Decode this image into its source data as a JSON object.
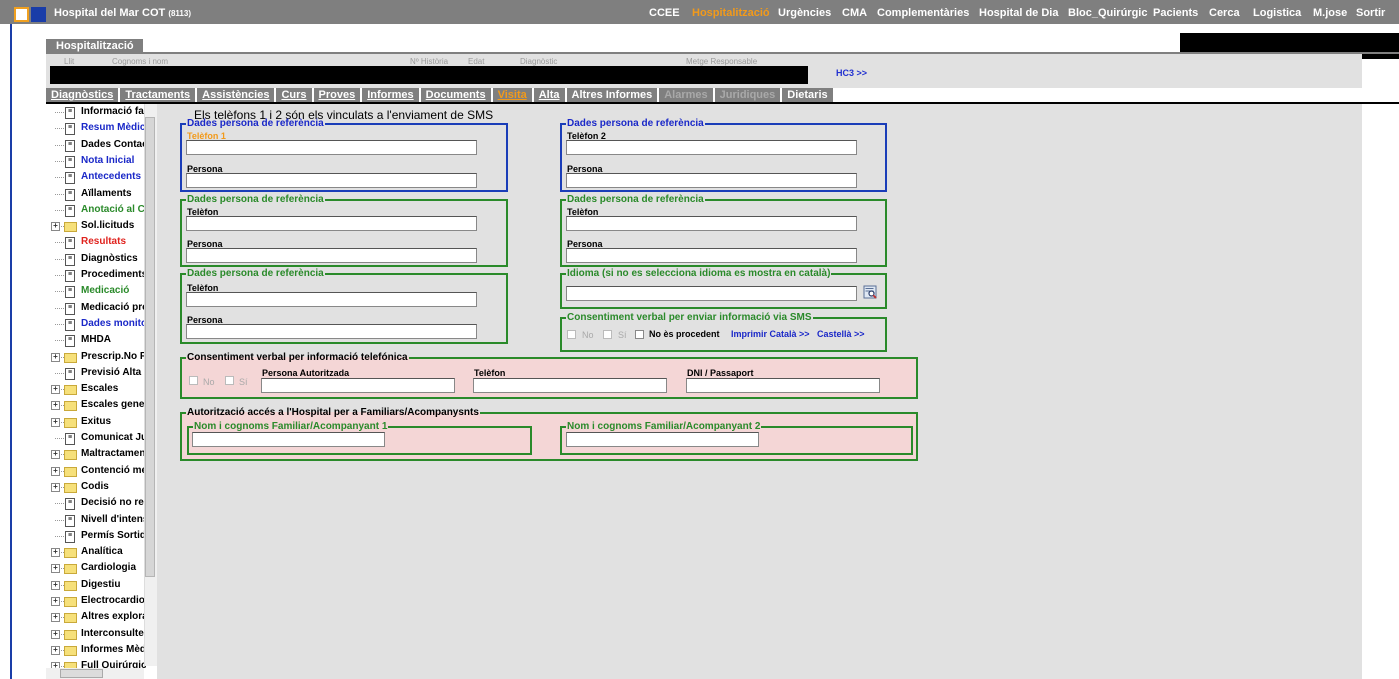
{
  "topbar": {
    "app_title": "Hospital del Mar  COT",
    "app_code": "(8113)",
    "menu": [
      "CCEE",
      "Hospitalització",
      "Urgències",
      "CMA",
      "Complementàries",
      "Hospital de Dia",
      "Bloc_Quirúrgic",
      "Pacients",
      "Cerca",
      "Logistica",
      "M.jose",
      "Sortir"
    ],
    "active_menu": "Hospitalització"
  },
  "patient_header": {
    "tab_label": "Hospitalització",
    "captions": {
      "llit": "Llit",
      "cognoms": "Cognoms i nom",
      "historia": "Nº Història",
      "edat": "Edat",
      "diagnostic": "Diagnòstic",
      "metge": "Metge Responsable"
    },
    "hc3_link": "HC3 >>"
  },
  "tabs": [
    "Diagnòstics",
    "Tractaments",
    "Assistències",
    "Curs",
    "Proves",
    "Informes",
    "Documents",
    "Visita",
    "Alta",
    "Altres Informes",
    "Alarmes",
    "Juridiques",
    "Dietaris"
  ],
  "tree": [
    {
      "label": "Informació fam",
      "kind": "doc",
      "color": "black"
    },
    {
      "label": "Resum Mèdic",
      "kind": "doc",
      "color": "blue"
    },
    {
      "label": "Dades Contacte",
      "kind": "doc",
      "color": "black"
    },
    {
      "label": "Nota Inicial",
      "kind": "doc",
      "color": "blue"
    },
    {
      "label": "Antecedents",
      "kind": "doc",
      "color": "blue"
    },
    {
      "label": "Aïllaments",
      "kind": "doc",
      "color": "black"
    },
    {
      "label": "Anotació al Cur",
      "kind": "doc",
      "color": "green"
    },
    {
      "label": "Sol.licituds",
      "kind": "folder",
      "color": "black"
    },
    {
      "label": "Resultats",
      "kind": "doc",
      "color": "red"
    },
    {
      "label": "Diagnòstics",
      "kind": "doc",
      "color": "black"
    },
    {
      "label": "Procediments",
      "kind": "doc",
      "color": "black"
    },
    {
      "label": "Medicació",
      "kind": "doc",
      "color": "green"
    },
    {
      "label": "Medicació prev",
      "kind": "doc",
      "color": "black"
    },
    {
      "label": "Dades monitor",
      "kind": "doc",
      "color": "blue"
    },
    {
      "label": "MHDA",
      "kind": "doc",
      "color": "black"
    },
    {
      "label": "Prescrip.No Fa",
      "kind": "folder",
      "color": "black"
    },
    {
      "label": "Previsió Alta / A",
      "kind": "doc",
      "color": "black"
    },
    {
      "label": "Escales",
      "kind": "folder",
      "color": "black"
    },
    {
      "label": "Escales genera",
      "kind": "folder",
      "color": "black"
    },
    {
      "label": "Exitus",
      "kind": "folder",
      "color": "black"
    },
    {
      "label": "Comunicat Jud",
      "kind": "doc",
      "color": "black"
    },
    {
      "label": "Maltractament",
      "kind": "folder",
      "color": "black"
    },
    {
      "label": "Contenció mec",
      "kind": "folder",
      "color": "black"
    },
    {
      "label": "Codis",
      "kind": "folder",
      "color": "black"
    },
    {
      "label": "Decisió no rean",
      "kind": "doc",
      "color": "black"
    },
    {
      "label": "Nivell d'intensit",
      "kind": "doc",
      "color": "black"
    },
    {
      "label": "Permís Sortida",
      "kind": "doc",
      "color": "black"
    },
    {
      "label": "Analítica",
      "kind": "folder",
      "color": "black"
    },
    {
      "label": "Cardiologia",
      "kind": "folder",
      "color": "black"
    },
    {
      "label": "Digestiu",
      "kind": "folder",
      "color": "black"
    },
    {
      "label": "Electrocardiogr",
      "kind": "folder",
      "color": "black"
    },
    {
      "label": "Altres explorac",
      "kind": "folder",
      "color": "black"
    },
    {
      "label": "Interconsultes",
      "kind": "folder",
      "color": "black"
    },
    {
      "label": "Informes Mèdic",
      "kind": "folder",
      "color": "black"
    },
    {
      "label": "Full Quirúrgic",
      "kind": "folder",
      "color": "black"
    }
  ],
  "form": {
    "sms_note": "Els telèfons 1 i 2 són els vinculats a l'enviament de SMS",
    "ref1": {
      "legend": "Dades persona de referència",
      "phone_label": "Telèfon 1",
      "person_label": "Persona",
      "phone": "",
      "person": ""
    },
    "ref2": {
      "legend": "Dades persona de referència",
      "phone_label": "Telèfon 2",
      "person_label": "Persona",
      "phone": "",
      "person": ""
    },
    "ref3": {
      "legend": "Dades persona de referència",
      "phone_label": "Telèfon",
      "person_label": "Persona",
      "phone": "",
      "person": ""
    },
    "ref4": {
      "legend": "Dades persona de referència",
      "phone_label": "Telèfon",
      "person_label": "Persona",
      "phone": "",
      "person": ""
    },
    "ref5": {
      "legend": "Dades persona de referència",
      "phone_label": "Telèfon",
      "person_label": "Persona",
      "phone": "",
      "person": ""
    },
    "idioma": {
      "legend": "Idioma (si no es selecciona idioma es mostra en català)",
      "value": ""
    },
    "sms_consent": {
      "legend": "Consentiment verbal per enviar informació via SMS",
      "no": "No",
      "si": "Sí",
      "not_applicable": "No ès procedent",
      "print_cat": "Imprimir Català >>",
      "print_es": "Castellà >>"
    },
    "phone_consent": {
      "legend": "Consentiment verbal per informació telefónica",
      "no": "No",
      "si": "Sí",
      "person_label": "Persona Autoritzada",
      "phone_label": "Telèfon",
      "dni_label": "DNI / Passaport"
    },
    "access": {
      "legend": "Autorització accés a l'Hospital per a Familiars/Acompanysnts",
      "comp1_legend": "Nom i cognoms Familiar/Acompanyant 1",
      "comp2_legend": "Nom i cognoms Familiar/Acompanyant 2"
    }
  }
}
